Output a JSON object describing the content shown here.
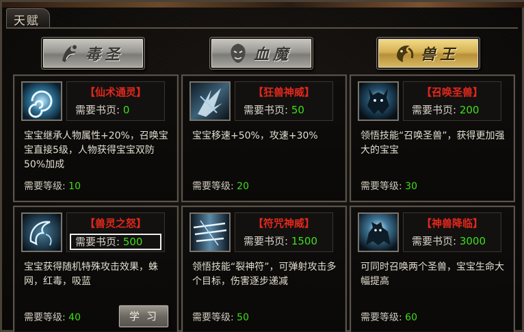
{
  "window": {
    "title": "天赋"
  },
  "class_tabs": [
    {
      "label": "毒圣",
      "active": false
    },
    {
      "label": "血魔",
      "active": false
    },
    {
      "label": "兽王",
      "active": true
    }
  ],
  "cost_label": "需要书页:",
  "level_label": "需要等级:",
  "colors": {
    "name": "#e0281d",
    "number": "#3fe018",
    "active_tab": "#d5b253"
  },
  "talents": [
    {
      "name": "【仙术通灵】",
      "cost": "0",
      "desc": "宝宝继承人物属性+20%，召唤宝宝直接5级，人物获得宝宝双防50%加成",
      "level": "10",
      "icon": "vortex-icon"
    },
    {
      "name": "【狂兽神威】",
      "cost": "50",
      "desc": "宝宝移速+50%，攻速+30%",
      "level": "20",
      "icon": "beast-slash-icon"
    },
    {
      "name": "【召唤圣兽】",
      "cost": "200",
      "desc": "领悟技能“召唤圣兽”，获得更加强大的宝宝",
      "level": "30",
      "icon": "summon-beast-icon"
    },
    {
      "name": "【兽灵之怒】",
      "cost": "500",
      "desc": "宝宝获得随机特殊攻击效果，蛛网，红毒，吸蓝",
      "level": "40",
      "icon": "spirit-fury-icon",
      "selected": true,
      "learn_label": "学习"
    },
    {
      "name": "【符咒神威】",
      "cost": "1500",
      "desc": "领悟技能“裂神符”，可弹射攻击多个目标，伤害逐步递减",
      "level": "50",
      "icon": "talisman-icon"
    },
    {
      "name": "【神兽降临】",
      "cost": "3000",
      "desc": "可同时召唤两个圣兽，宝宝生命大幅提高",
      "level": "60",
      "icon": "divine-beast-icon"
    }
  ]
}
